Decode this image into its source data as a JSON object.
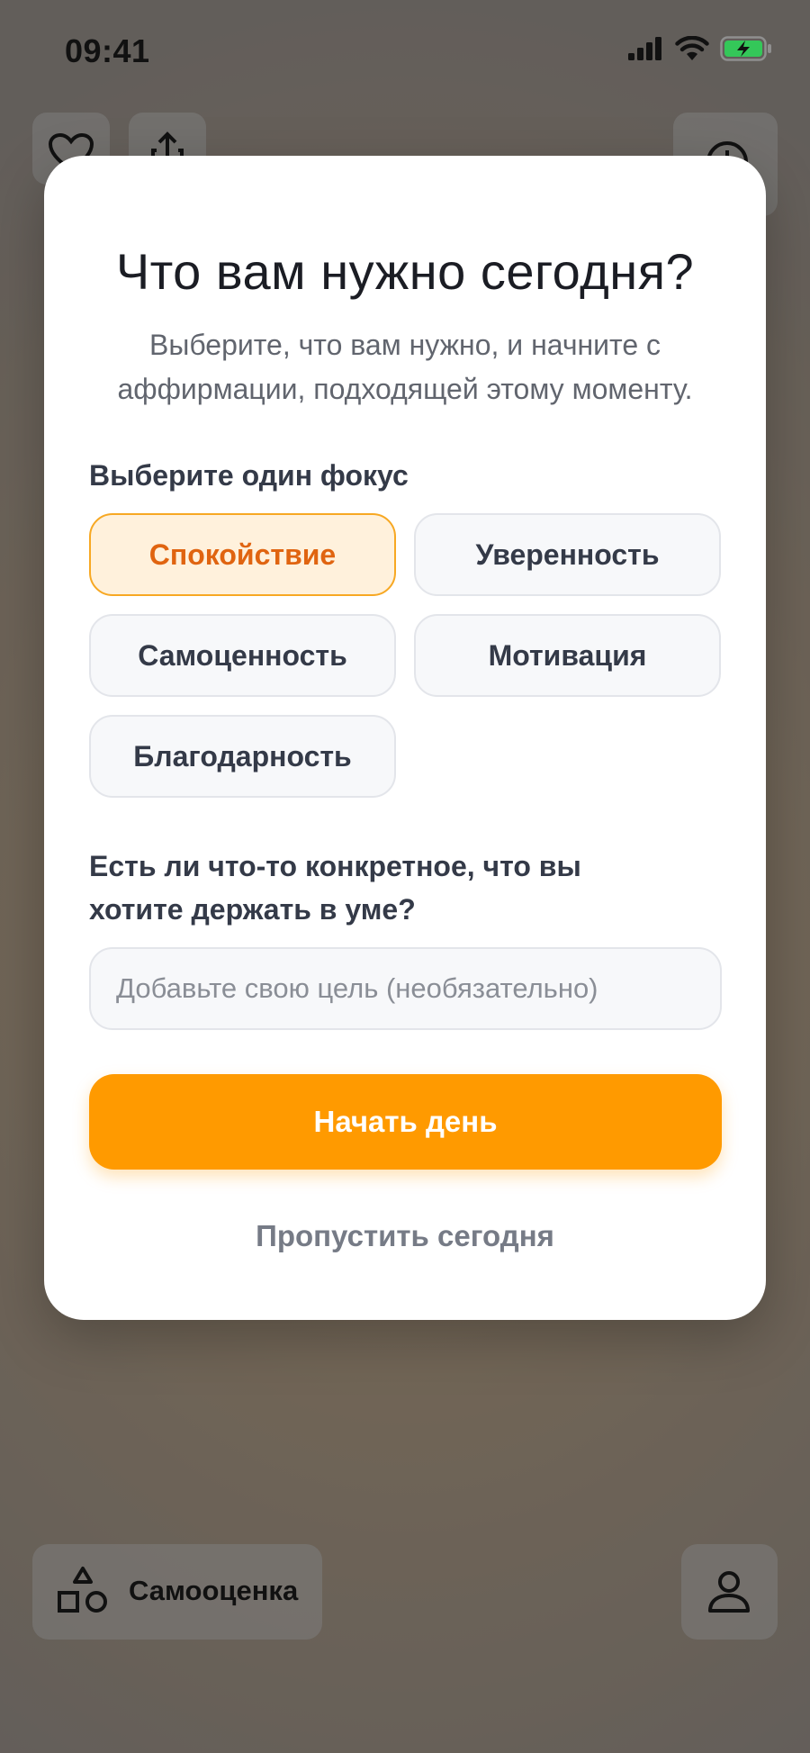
{
  "status_bar": {
    "time": "09:41",
    "icons": [
      "signal-icon",
      "wifi-icon",
      "battery-charging-icon"
    ]
  },
  "background": {
    "top_buttons": [
      "heart-icon",
      "share-icon",
      "clock-icon"
    ],
    "bottom": {
      "category_label": "Самооценка",
      "category_icon": "shapes-icon",
      "profile_icon": "person-icon"
    }
  },
  "modal": {
    "title": "Что вам нужно сегодня?",
    "subtitle_line1": "Выберите, что вам нужно, и начните с",
    "subtitle_line2": "аффирмации, подходящей этому моменту.",
    "focus_label": "Выберите один фокус",
    "focus_options": [
      {
        "label": "Спокойствие",
        "selected": true
      },
      {
        "label": "Уверенность",
        "selected": false
      },
      {
        "label": "Самоценность",
        "selected": false
      },
      {
        "label": "Мотивация",
        "selected": false
      },
      {
        "label": "Благодарность",
        "selected": false
      }
    ],
    "goal_question_line1": "Есть ли что-то конкретное, что вы",
    "goal_question_line2": "хотите держать в уме?",
    "goal_input": {
      "value": "",
      "placeholder": "Добавьте свою цель (необязательно)"
    },
    "start_button": "Начать день",
    "skip_link": "Пропустить сегодня"
  },
  "colors": {
    "accent": "#ff9a00",
    "selected_chip_bg": "#fff1dc",
    "selected_chip_text": "#e06410",
    "battery": "#34c759"
  }
}
